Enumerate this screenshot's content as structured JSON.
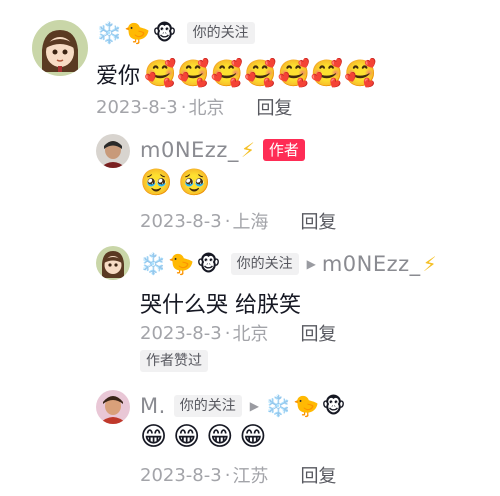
{
  "comments": [
    {
      "user": {
        "nick": "",
        "badges": [
          "❄️",
          "🐤",
          "🐵"
        ],
        "follow_tag": "你的关注"
      },
      "text": "爱你",
      "text_emojis": [
        "🥰",
        "🥰",
        "🥰",
        "🥰",
        "🥰",
        "🥰",
        "🥰"
      ],
      "date": "2023-8-3",
      "location": "北京",
      "reply_label": "回复"
    },
    {
      "user": {
        "nick": "m0NEzz_",
        "bolt": "⚡",
        "author_tag": "作者"
      },
      "text": "",
      "text_emojis": [
        "🥹",
        "🥹"
      ],
      "date": "2023-8-3",
      "location": "上海",
      "reply_label": "回复"
    },
    {
      "user": {
        "badges": [
          "❄️",
          "🐤",
          "🐵"
        ],
        "follow_tag": "你的关注",
        "reply_to": "m0NEzz_",
        "reply_to_bolt": "⚡"
      },
      "text": "哭什么哭 给朕笑",
      "date": "2023-8-3",
      "location": "北京",
      "reply_label": "回复",
      "liked_tag": "作者赞过"
    },
    {
      "user": {
        "nick": "M.",
        "follow_tag": "你的关注",
        "reply_to_badges": [
          "❄️",
          "🐤",
          "🐵"
        ]
      },
      "text": "",
      "text_emojis": [
        "😁",
        "😁",
        "😁",
        "😁"
      ],
      "date": "2023-8-3",
      "location": "江苏",
      "reply_label": "回复"
    }
  ],
  "colors": {
    "author_tag": "#fe2c55",
    "meta": "#a3a4a9",
    "follow_tag_bg": "#f1f1f2"
  }
}
